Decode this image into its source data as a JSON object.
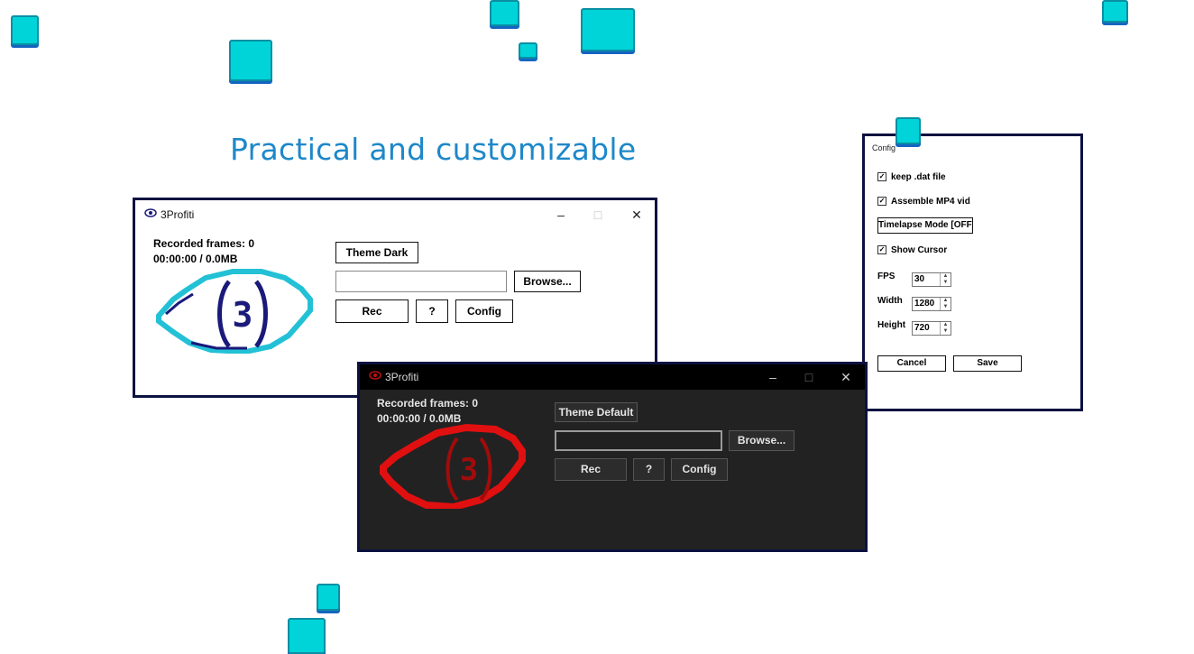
{
  "headline": "Practical and customizable",
  "colors": {
    "accent_blue": "#1e88c9",
    "square_fill": "#00d4d8",
    "window_border": "#0b1240",
    "dark_bg": "#222222",
    "eye_light_outline": "#22c1d6",
    "eye_light_iris": "#1a1a7a",
    "eye_dark": "#e01010"
  },
  "light_window": {
    "title": "3Profiti",
    "icon": "eye-logo-icon",
    "controls": {
      "minimize": "–",
      "maximize": "□",
      "close": "✕"
    },
    "recorded_frames": "Recorded frames: 0",
    "time_size": "00:00:00 / 0.0MB",
    "theme_button": "Theme Dark",
    "path_value": "",
    "browse_button": "Browse...",
    "rec_button": "Rec",
    "help_button": "?",
    "config_button": "Config",
    "logo_digit": "3"
  },
  "dark_window": {
    "title": "3Profiti",
    "icon": "eye-logo-icon",
    "controls": {
      "minimize": "–",
      "maximize": "□",
      "close": "✕"
    },
    "recorded_frames": "Recorded frames: 0",
    "time_size": "00:00:00 / 0.0MB",
    "theme_button": "Theme Default",
    "path_value": "",
    "browse_button": "Browse...",
    "rec_button": "Rec",
    "help_button": "?",
    "config_button": "Config",
    "logo_digit": "3"
  },
  "config_window": {
    "title": "Config",
    "keep_dat": {
      "label": "keep .dat file",
      "checked": true,
      "mark": "✓"
    },
    "assemble_mp4": {
      "label": "Assemble MP4 vid",
      "checked": true,
      "mark": "✓"
    },
    "timelapse_button": "Timelapse Mode [OFF]",
    "show_cursor": {
      "label": "Show Cursor",
      "checked": true,
      "mark": "✓"
    },
    "fps": {
      "label": "FPS",
      "value": "30"
    },
    "width": {
      "label": "Width",
      "value": "1280"
    },
    "height": {
      "label": "Height",
      "value": "720"
    },
    "spin_up": "▲",
    "spin_down": "▼",
    "cancel_button": "Cancel",
    "save_button": "Save"
  }
}
